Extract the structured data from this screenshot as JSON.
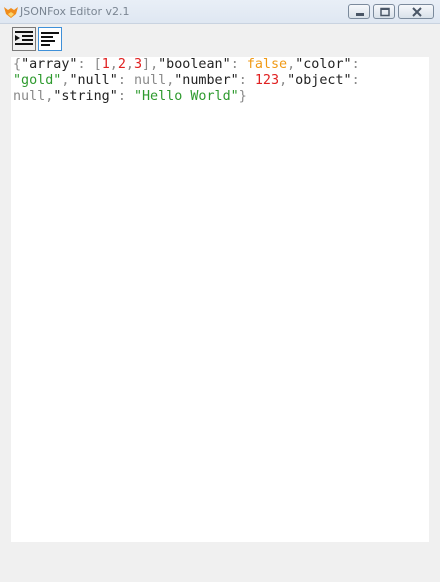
{
  "window": {
    "title": "JSONFox Editor v2.1",
    "icon": "fox-icon"
  },
  "toolbar": {
    "buttons": [
      {
        "name": "format-json-button",
        "icon": "indent-icon",
        "active": false
      },
      {
        "name": "compact-json-button",
        "icon": "align-left-icon",
        "active": true
      }
    ]
  },
  "editor": {
    "tokens": {
      "open_brace": "{",
      "k_array": "\"array\"",
      "colon": ":",
      "comma": ",",
      "open_bracket": "[",
      "n1": "1",
      "n2": "2",
      "n3": "3",
      "close_bracket": "]",
      "k_boolean": "\"boolean\"",
      "v_false": "false",
      "k_color": "\"color\"",
      "v_gold": "\"gold\"",
      "k_null": "\"null\"",
      "v_null": "null",
      "k_number": "\"number\"",
      "v_number": "123",
      "k_object": "\"object\"",
      "k_string": "\"string\"",
      "v_string": "\"Hello World\"",
      "close_brace": "}"
    }
  },
  "colors": {
    "number": "#e02020",
    "boolean": "#f09a16",
    "string": "#2e9a2e",
    "null": "#8a8a8a",
    "punctuation": "#8a8a8a"
  }
}
